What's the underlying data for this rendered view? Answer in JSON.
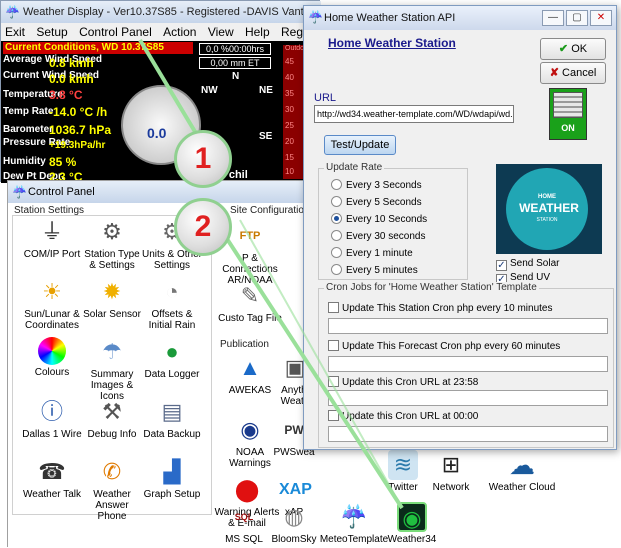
{
  "main_window": {
    "title": "Weather Display - Ver10.37S85 - Registered  -DAVIS Vantage Pro  W",
    "menu": [
      "Exit",
      "Setup",
      "Control Panel",
      "Action",
      "View",
      "Help",
      "Register/Pur"
    ],
    "header": "Current Conditions, WD 10.37S85",
    "rows": [
      {
        "label": "Average Wind Speed",
        "value": "0.8 kmh"
      },
      {
        "label": "Current Wind Speed",
        "value": "0.0 kmh"
      },
      {
        "label": "Temperature",
        "value": "3.8 °C"
      },
      {
        "label": "Temp Rate",
        "value": "-14.0 °C /h"
      },
      {
        "label": "Barometer",
        "value": "1036.7 hPa"
      },
      {
        "label": "Pressure Rate",
        "value": "+19.3hPa/hr"
      },
      {
        "label": "Humidity",
        "value": "85 %"
      },
      {
        "label": "Dew Pt Depr.",
        "value": "2.3 °C"
      }
    ],
    "rain_today": "0,0 %00:00hrs",
    "rain_et": "0,00 mm ET",
    "gauge_value": "0.0",
    "wind_chill_label": "Wind chil",
    "compass": {
      "n": "N",
      "nw": "NW",
      "ne": "NE",
      "se": "SE"
    },
    "thermo_label": "Outdoor T",
    "thermo_ticks": [
      "45",
      "40",
      "35",
      "30",
      "25",
      "20",
      "15",
      "10"
    ]
  },
  "callouts": [
    "1",
    "2"
  ],
  "control_panel": {
    "title": "Control Panel",
    "station_settings_label": "Station Settings",
    "site_config_label": "Site Configuratio",
    "publication_label": "Publication",
    "items_left": [
      {
        "label": "COM/IP Port",
        "icon": "plug-icon"
      },
      {
        "label": "Station Type & Settings",
        "icon": "station-icon"
      },
      {
        "label": "Units & Other Settings",
        "icon": "gear-icon"
      },
      {
        "label": "Sun/Lunar & Coordinates",
        "icon": "sun-icon"
      },
      {
        "label": "Solar Sensor",
        "icon": "solar-icon"
      },
      {
        "label": "Offsets & Initial Rain",
        "icon": "offsets-icon"
      },
      {
        "label": "Colours",
        "icon": "colours-icon"
      },
      {
        "label": "Summary Images & Icons",
        "icon": "summary-icon"
      },
      {
        "label": "Data Logger",
        "icon": "logger-icon"
      },
      {
        "label": "Dallas 1 Wire",
        "icon": "info-icon"
      },
      {
        "label": "Debug Info",
        "icon": "debug-icon"
      },
      {
        "label": "Data Backup",
        "icon": "backup-icon"
      },
      {
        "label": "Weather Talk",
        "icon": "talk-icon"
      },
      {
        "label": "Weather Answer Phone",
        "icon": "phone-icon"
      },
      {
        "label": "Graph Setup",
        "icon": "graph-icon"
      }
    ],
    "items_right": [
      {
        "label": "P & Connections AR/NOAA",
        "icon": "ftp-icon"
      },
      {
        "label": "Custo Tag File",
        "icon": "custom-tag-icon"
      },
      {
        "label": "AWEKAS",
        "icon": "awekas-icon"
      },
      {
        "label": "Anythi Weath",
        "icon": "anything-icon"
      },
      {
        "label": "NOAA Warnings",
        "icon": "noaa-icon"
      },
      {
        "label": "PWSwea",
        "icon": "pws-icon"
      },
      {
        "label": "Warning Alerts & E-mail",
        "icon": "warning-icon"
      },
      {
        "label": "xAP",
        "icon": "xap-icon"
      }
    ],
    "items_bottom": [
      {
        "label": "Twitter",
        "icon": "twitter-icon"
      },
      {
        "label": "Network",
        "icon": "network-icon"
      },
      {
        "label": "Weather Cloud",
        "icon": "cloud-icon"
      },
      {
        "label": "MS SQL",
        "icon": "sql-icon"
      },
      {
        "label": "BloomSky",
        "icon": "bloomsky-icon"
      },
      {
        "label": "MeteoTemplate",
        "icon": "meteo-icon"
      },
      {
        "label": "Weather34",
        "icon": "weather34-icon"
      }
    ]
  },
  "api_dialog": {
    "title": "Home Weather Station API",
    "link": "Home Weather Station",
    "ok_label": "OK",
    "cancel_label": "Cancel",
    "url_label": "URL",
    "url_value": "http://wd34.weather-template.com/WD/wdapi/wd.ph",
    "switch_label": "ON",
    "test_label": "Test/Update",
    "update_rate_label": "Update Rate",
    "rates": [
      "Every 3 Seconds",
      "Every 5 Seconds",
      "Every 10 Seconds",
      "Every 30 seconds",
      "Every 1 minute",
      "Every 5 minutes"
    ],
    "selected_rate": "Every 10 Seconds",
    "logo": {
      "line1": "HOME",
      "line2": "WEATHER",
      "line3": "STATION"
    },
    "send_solar": "Send Solar",
    "send_uv": "Send UV",
    "cron_group_label": "Cron Jobs for 'Home Weather Station' Template",
    "cron_items": [
      "Update This Station Cron php every 10 minutes",
      "Update This Forecast Cron php every 60 minutes",
      "Update this Cron URL at 23:58",
      "Update this Cron URL at 00:00"
    ]
  }
}
